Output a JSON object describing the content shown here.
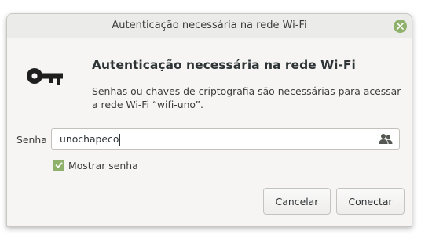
{
  "window": {
    "title": "Autenticação necessária na rede Wi-Fi"
  },
  "dialog": {
    "heading": "Autenticação necessária na rede Wi-Fi",
    "description": "Senhas ou chaves de criptografia são necessárias para acessar a rede Wi-Fi “wifi-uno”.",
    "icon": "key-icon"
  },
  "password": {
    "label": "Senha",
    "value": "unochapeco",
    "secondary_icon": "users-icon"
  },
  "show_password": {
    "label": "Mostrar senha",
    "checked": true
  },
  "buttons": {
    "cancel": "Cancelar",
    "connect": "Conectar"
  },
  "colors": {
    "accent": "#8fb16b",
    "text": "#3d3d3d",
    "background": "#f6f5f4"
  }
}
